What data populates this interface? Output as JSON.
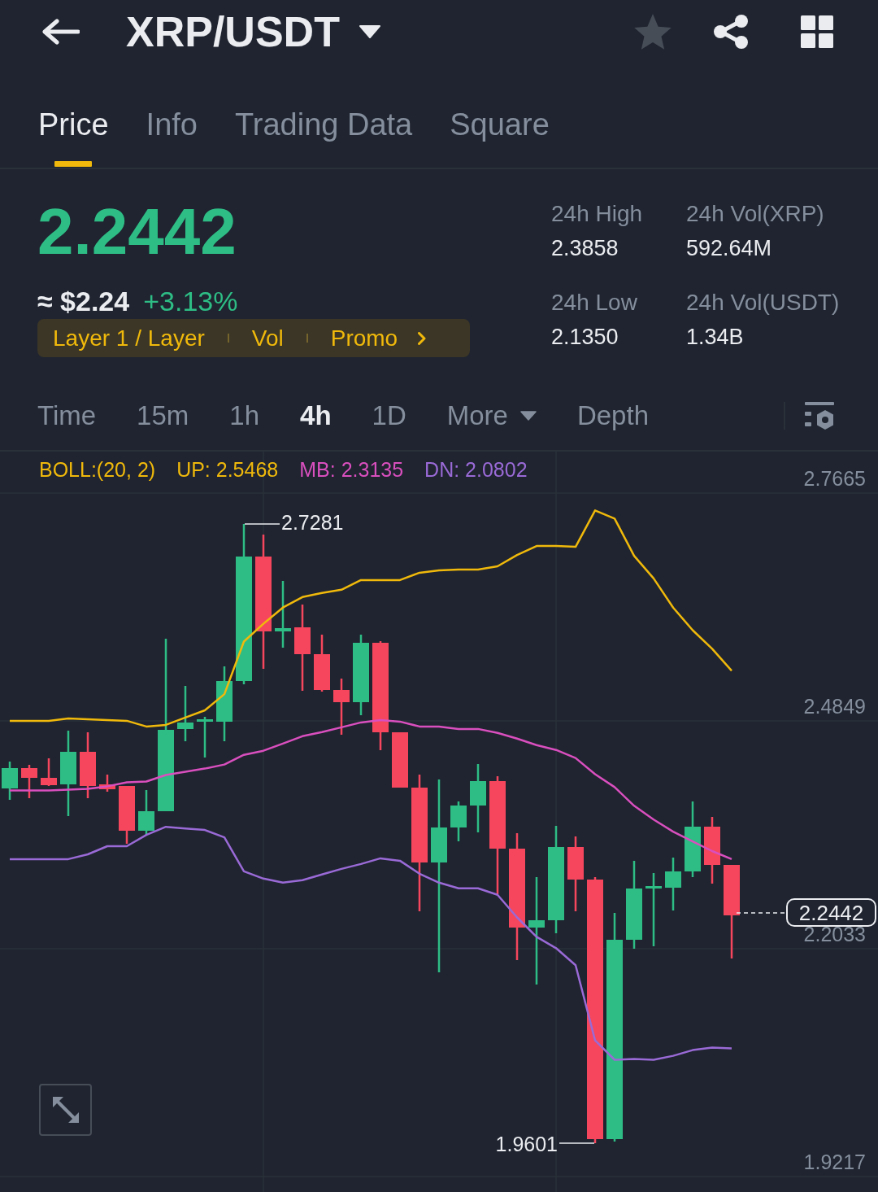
{
  "header": {
    "title": "XRP/USDT",
    "favorited": false
  },
  "tabs": [
    {
      "label": "Price",
      "selected": true
    },
    {
      "label": "Info",
      "selected": false
    },
    {
      "label": "Trading Data",
      "selected": false
    },
    {
      "label": "Square",
      "selected": false
    }
  ],
  "ticker": {
    "price": "2.2442",
    "fiat_price": "≈ $2.24",
    "change": "+3.13%",
    "tags": [
      "Layer 1 / Layer",
      "Vol",
      "Promo"
    ],
    "stats": [
      {
        "label": "24h High",
        "value": "2.3858"
      },
      {
        "label": "24h Vol(XRP)",
        "value": "592.64M"
      },
      {
        "label": "24h Low",
        "value": "2.1350"
      },
      {
        "label": "24h Vol(USDT)",
        "value": "1.34B"
      }
    ]
  },
  "intervals": [
    {
      "label": "Time",
      "kind": "option",
      "selected": false
    },
    {
      "label": "15m",
      "kind": "option",
      "selected": false
    },
    {
      "label": "1h",
      "kind": "option",
      "selected": false
    },
    {
      "label": "4h",
      "kind": "option",
      "selected": true
    },
    {
      "label": "1D",
      "kind": "option",
      "selected": false
    },
    {
      "label": "More",
      "kind": "dropdown",
      "selected": false
    },
    {
      "label": "Depth",
      "kind": "option",
      "selected": false
    }
  ],
  "chart": {
    "chart_data": {
      "type": "line",
      "title": "BOLL:(20, 2)",
      "grid": true,
      "categories": [
        null,
        null,
        null,
        null,
        null,
        null,
        null,
        null,
        null,
        null,
        null,
        null,
        null,
        null,
        null,
        null,
        null,
        null,
        null,
        null,
        null,
        null,
        null,
        null,
        null,
        null,
        null,
        null,
        null,
        null,
        null,
        null,
        null,
        null,
        null,
        null,
        null,
        null
      ],
      "ylim": [
        1.9026,
        2.8178
      ],
      "yticks": [
        {
          "value": 2.7665,
          "label": "2.7665"
        },
        {
          "value": 2.4849,
          "label": "2.4849"
        },
        {
          "value": 2.2033,
          "label": "2.2033"
        },
        {
          "value": 1.9217,
          "label": "1.9217"
        }
      ],
      "series": [
        {
          "name": "UP: 2.5468",
          "color": "#f0b90b",
          "values": [
            2.485,
            2.485,
            2.485,
            2.488,
            2.487,
            2.486,
            2.485,
            2.478,
            2.48,
            2.489,
            2.498,
            2.518,
            2.583,
            2.605,
            2.625,
            2.638,
            2.643,
            2.647,
            2.659,
            2.659,
            2.659,
            2.668,
            2.671,
            2.672,
            2.672,
            2.676,
            2.69,
            2.701,
            2.701,
            2.7,
            2.745,
            2.735,
            2.689,
            2.661,
            2.625,
            2.597,
            2.574,
            2.547
          ]
        },
        {
          "name": "MB: 2.3135",
          "color": "#d94fbe",
          "values": [
            2.399,
            2.399,
            2.399,
            2.4,
            2.401,
            2.404,
            2.409,
            2.41,
            2.418,
            2.422,
            2.426,
            2.431,
            2.443,
            2.448,
            2.457,
            2.466,
            2.471,
            2.477,
            2.483,
            2.486,
            2.484,
            2.478,
            2.478,
            2.475,
            2.475,
            2.47,
            2.463,
            2.455,
            2.449,
            2.439,
            2.419,
            2.403,
            2.38,
            2.363,
            2.348,
            2.336,
            2.324,
            2.314
          ]
        },
        {
          "name": "DN: 2.0802",
          "color": "#9a6ad6",
          "values": [
            2.314,
            2.314,
            2.314,
            2.314,
            2.32,
            2.33,
            2.33,
            2.344,
            2.354,
            2.352,
            2.35,
            2.341,
            2.299,
            2.29,
            2.285,
            2.288,
            2.295,
            2.302,
            2.308,
            2.315,
            2.312,
            2.296,
            2.285,
            2.278,
            2.278,
            2.27,
            2.242,
            2.218,
            2.204,
            2.183,
            2.09,
            2.066,
            2.067,
            2.066,
            2.071,
            2.078,
            2.081,
            2.08
          ]
        }
      ]
    },
    "high_label": "2.7281",
    "low_label": "1.9601",
    "last_price": "2.2442"
  }
}
